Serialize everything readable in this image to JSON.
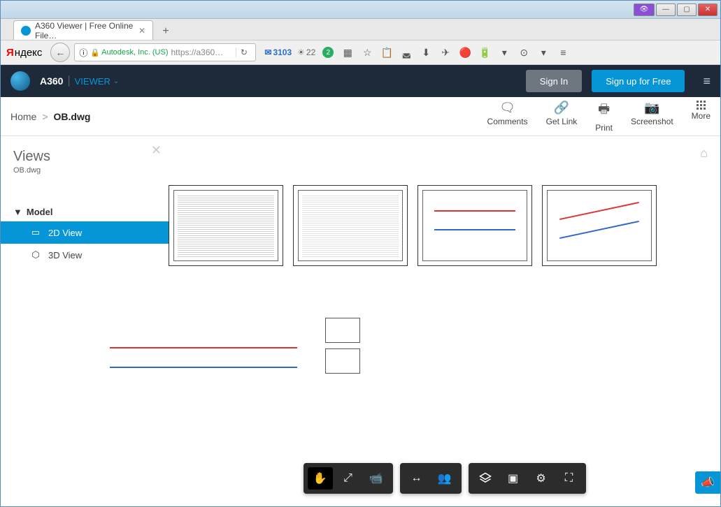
{
  "window": {
    "tab_title": "A360 Viewer | Free Online File…",
    "browser_brand_y": "Я",
    "browser_brand_rest": "ндекс",
    "ssl_org": "Autodesk, Inc. (US)",
    "url": "https://a360…",
    "mail_count": "3103",
    "weather_temp": "22",
    "badge_count": "2"
  },
  "header": {
    "app": "A360",
    "mode": "VIEWER",
    "signin": "Sign In",
    "signup": "Sign up for Free"
  },
  "breadcrumb": {
    "home": "Home",
    "sep": ">",
    "current": "OB.dwg"
  },
  "actions": {
    "comments": "Comments",
    "getlink": "Get Link",
    "print": "Print",
    "screenshot": "Screenshot",
    "more": "More"
  },
  "sidebar": {
    "title": "Views",
    "file": "OB.dwg",
    "group": "Model",
    "items": [
      {
        "label": "2D View"
      },
      {
        "label": "3D View"
      }
    ]
  }
}
